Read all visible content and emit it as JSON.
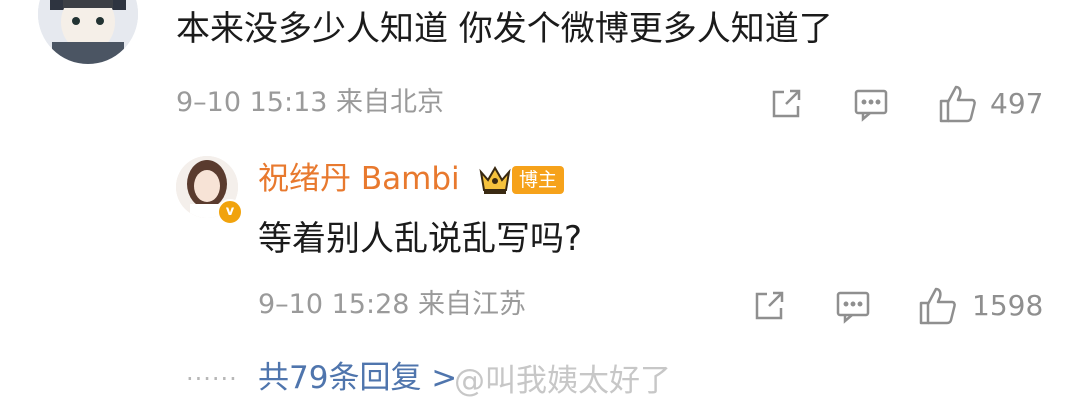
{
  "comment": {
    "text": "本来没多少人知道 你发个微博更多人知道了",
    "meta": "9–10 15:13 来自北京",
    "likes": "497"
  },
  "reply": {
    "author": "祝绪丹 Bambi",
    "badge": "博主",
    "text": "等着别人乱说乱写吗?",
    "meta": "9–10 15:28 来自江苏",
    "likes": "1598",
    "verified_icon": "v"
  },
  "more_replies": {
    "dots": "······",
    "label": "共79条回复 >"
  },
  "watermark": "@叫我姨太好了",
  "colors": {
    "name": "#e8792e",
    "badge": "#f6a21a",
    "link": "#4f75ad",
    "meta": "#9a9a9a"
  },
  "icons": [
    "share-icon",
    "comment-icon",
    "like-icon",
    "crown-icon",
    "verified-icon"
  ]
}
